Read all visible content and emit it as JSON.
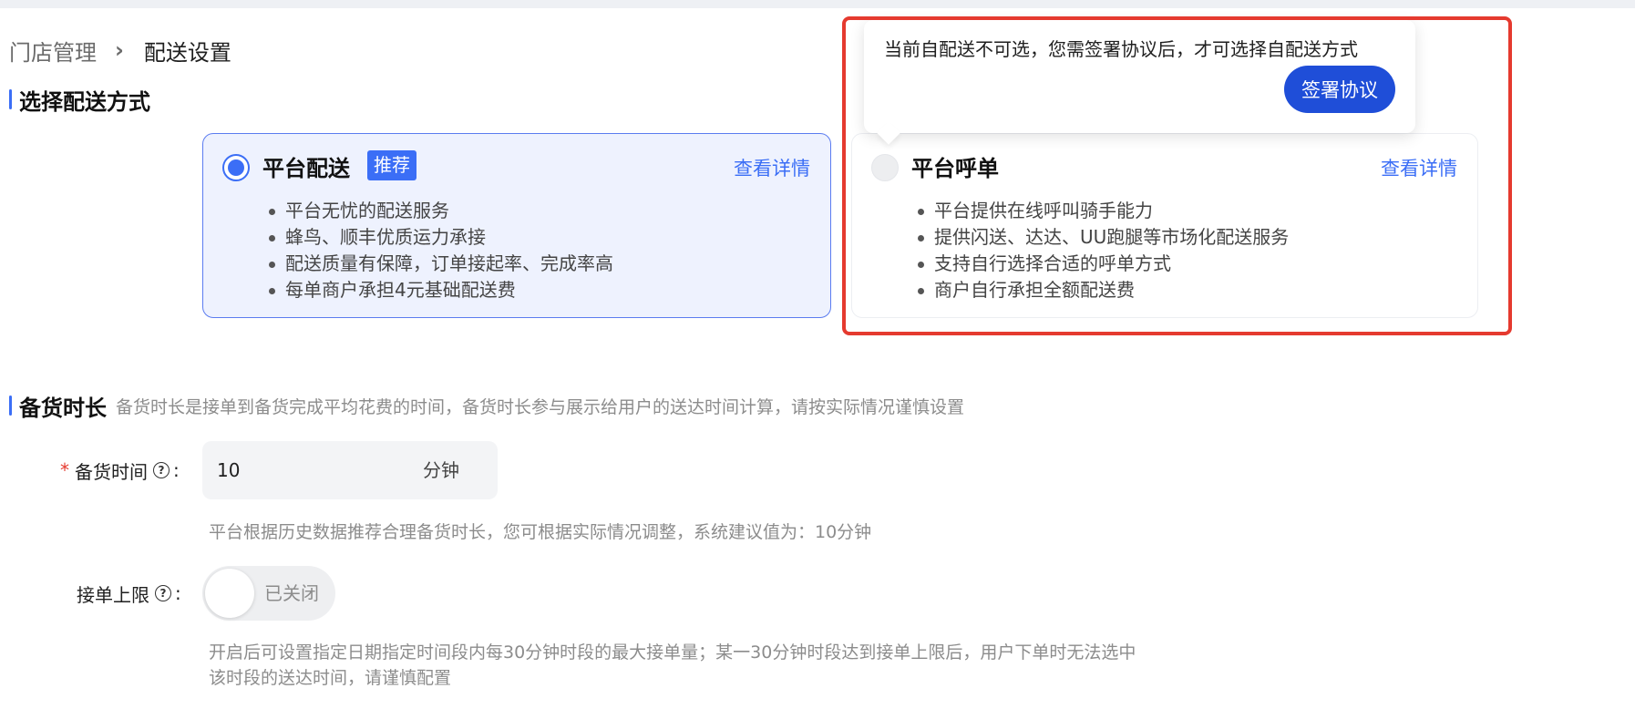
{
  "breadcrumb": {
    "parent": "门店管理",
    "separator": "›",
    "current": "配送设置"
  },
  "delivery_section": {
    "title": "选择配送方式"
  },
  "cards": {
    "platform": {
      "title": "平台配送",
      "badge": "推荐",
      "link": "查看详情",
      "selected": true,
      "features": [
        "平台无忧的配送服务",
        "蜂鸟、顺丰优质运力承接",
        "配送质量有保障，订单接起率、完成率高",
        "每单商户承担4元基础配送费"
      ]
    },
    "call": {
      "title": "平台呼单",
      "link": "查看详情",
      "selected": false,
      "features": [
        "平台提供在线呼叫骑手能力",
        "提供闪送、达达、UU跑腿等市场化配送服务",
        "支持自行选择合适的呼单方式",
        "商户自行承担全额配送费"
      ]
    }
  },
  "popover": {
    "text": "当前自配送不可选，您需签署协议后，才可选择自配送方式",
    "button": "签署协议"
  },
  "stock_section": {
    "title": "备货时长",
    "description": "备货时长是接单到备货完成平均花费的时间，备货时长参与展示给用户的送达时间计算，请按实际情况谨慎设置"
  },
  "stock_time": {
    "required_mark": "*",
    "label": "备货时间",
    "help": "?",
    "colon": ":",
    "value": "10",
    "unit": "分钟",
    "hint": "平台根据历史数据推荐合理备货时长，您可根据实际情况调整，系统建议值为：10分钟"
  },
  "order_limit": {
    "label": "接单上限",
    "help": "?",
    "colon": ":",
    "toggle_text": "已关闭",
    "enabled": false,
    "hint_line1": "开启后可设置指定日期指定时间段内每30分钟时段的最大接单量；某一30分钟时段达到接单上限后，用户下单时无法选中",
    "hint_line2": "该时段的送达时间，请谨慎配置"
  },
  "colors": {
    "accent": "#3b6ef6",
    "highlight_border": "#e53a2f",
    "button_primary": "#1f4ed8"
  }
}
